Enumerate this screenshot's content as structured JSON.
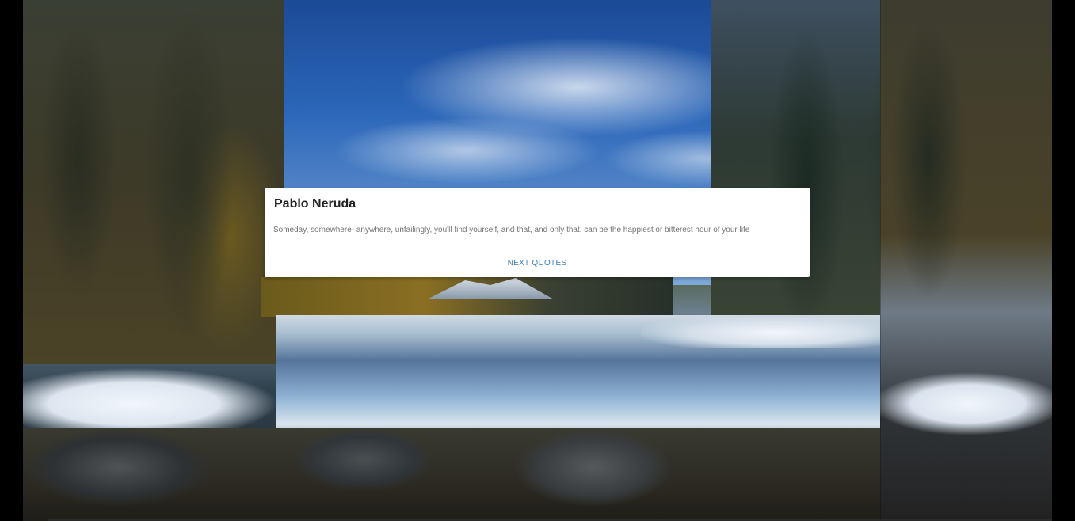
{
  "quote_card": {
    "author": "Pablo Neruda",
    "quote": "Someday, somewhere- anywhere, unfailingly, you'll find yourself, and that, and only that, can be the happiest or bitterest hour of your life",
    "next_button_label": "NEXT QUOTES"
  },
  "colors": {
    "card_background": "#ffffff",
    "title_text": "#222222",
    "quote_text": "#757575",
    "action_link": "#3f7fbf",
    "page_background": "#000000"
  }
}
